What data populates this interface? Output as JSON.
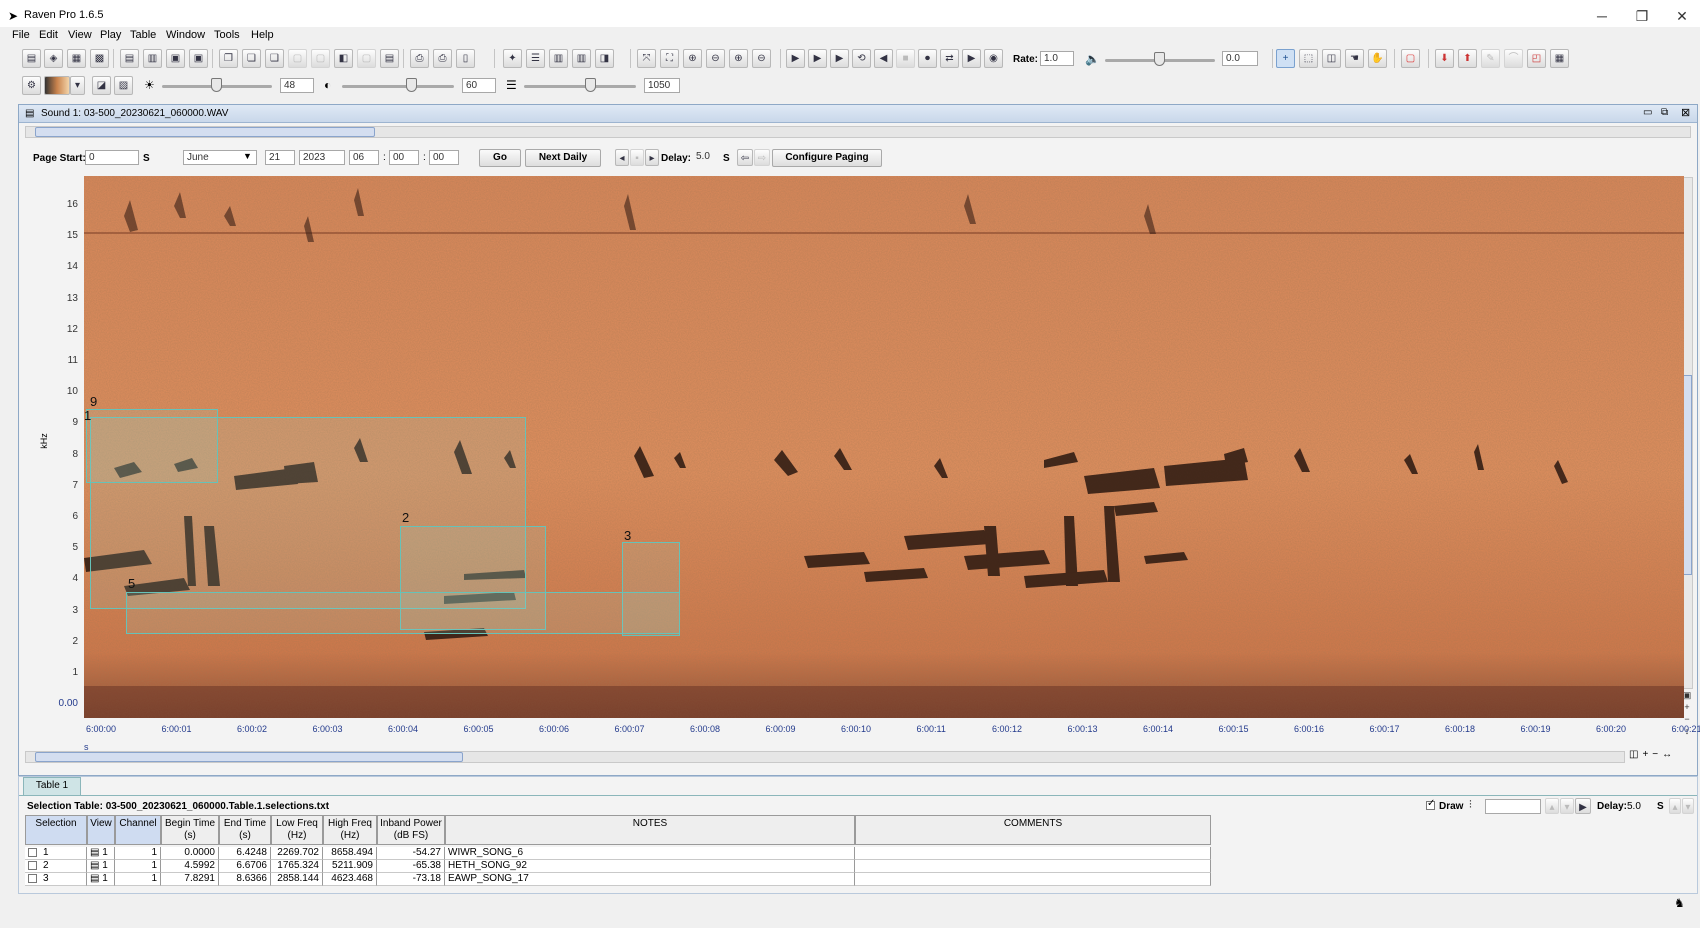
{
  "window": {
    "title": "Raven Pro 1.6.5"
  },
  "menu": [
    "File",
    "Edit",
    "View",
    "Play",
    "Table",
    "Window",
    "Tools",
    "Help"
  ],
  "toolbar": {
    "rate_label": "Rate:",
    "rate_value": "1.0",
    "volume_value": "0.0",
    "brightness_value": "48",
    "contrast_value": "60",
    "size_value": "1050"
  },
  "sound": {
    "title": "Sound 1: 03-500_20230621_060000.WAV",
    "page_start_label": "Page Start:",
    "page_start_value": "0",
    "page_start_unit": "S",
    "month": "June",
    "day": "21",
    "year": "2023",
    "hour": "06",
    "minute": "00",
    "second": "00",
    "go_label": "Go",
    "next_daily_label": "Next Daily",
    "delay_label": "Delay:",
    "delay_value": "5.0",
    "delay_unit": "S",
    "configure_paging_label": "Configure Paging"
  },
  "spectrogram": {
    "y_axis_label": "kHz",
    "x_axis_label": "s",
    "y_ticks": [
      "16",
      "15",
      "14",
      "13",
      "12",
      "11",
      "10",
      "9",
      "8",
      "7",
      "6",
      "5",
      "4",
      "3",
      "2",
      "1",
      "0.00"
    ],
    "x_ticks": [
      "6:00:00",
      "6:00:01",
      "6:00:02",
      "6:00:03",
      "6:00:04",
      "6:00:05",
      "6:00:06",
      "6:00:07",
      "6:00:08",
      "6:00:09",
      "6:00:10",
      "6:00:11",
      "6:00:12",
      "6:00:13",
      "6:00:14",
      "6:00:15",
      "6:00:16",
      "6:00:17",
      "6:00:18",
      "6:00:19",
      "6:00:20",
      "6:00:21"
    ],
    "selection_labels": [
      "9",
      "1",
      "2",
      "3",
      "5"
    ]
  },
  "table": {
    "tab_label": "Table 1",
    "title": "Selection Table: 03-500_20230621_060000.Table.1.selections.txt",
    "draw_label": "Draw",
    "delay_label": "Delay:",
    "delay_value": "5.0",
    "delay_unit": "S",
    "columns": [
      {
        "label": "Selection",
        "sub": ""
      },
      {
        "label": "View",
        "sub": ""
      },
      {
        "label": "Channel",
        "sub": ""
      },
      {
        "label": "Begin Time",
        "sub": "(s)"
      },
      {
        "label": "End Time",
        "sub": "(s)"
      },
      {
        "label": "Low Freq",
        "sub": "(Hz)"
      },
      {
        "label": "High Freq",
        "sub": "(Hz)"
      },
      {
        "label": "Inband Power",
        "sub": "(dB FS)"
      },
      {
        "label": "NOTES",
        "sub": ""
      },
      {
        "label": "COMMENTS",
        "sub": ""
      }
    ],
    "rows": [
      {
        "selection": "1",
        "view": "1",
        "channel": "1",
        "begin": "0.0000",
        "end": "6.4248",
        "low": "2269.702",
        "high": "8658.494",
        "power": "-54.27",
        "notes": "WIWR_SONG_6",
        "comments": ""
      },
      {
        "selection": "2",
        "view": "1",
        "channel": "1",
        "begin": "4.5992",
        "end": "6.6706",
        "low": "1765.324",
        "high": "5211.909",
        "power": "-65.38",
        "notes": "HETH_SONG_92",
        "comments": ""
      },
      {
        "selection": "3",
        "view": "1",
        "channel": "1",
        "begin": "7.8291",
        "end": "8.6366",
        "low": "2858.144",
        "high": "4623.468",
        "power": "-73.18",
        "notes": "EAWP_SONG_17",
        "comments": ""
      }
    ]
  }
}
